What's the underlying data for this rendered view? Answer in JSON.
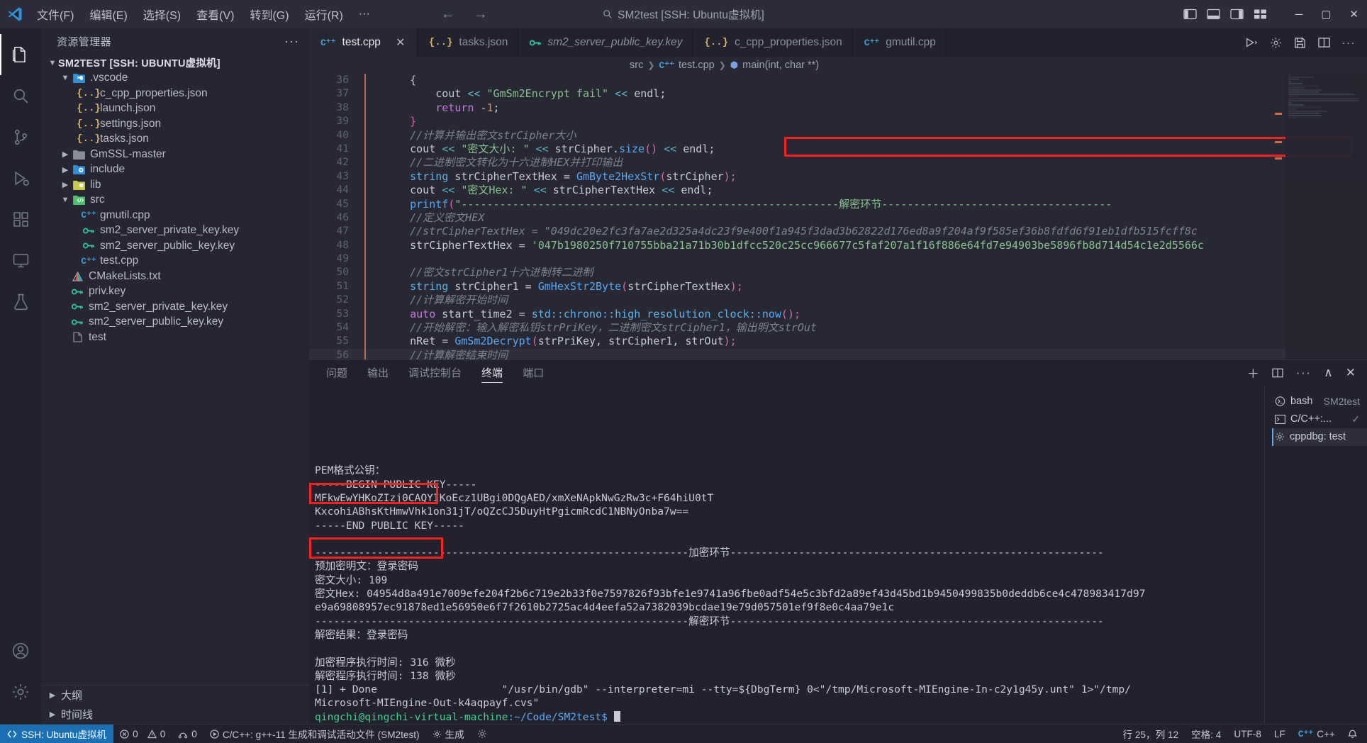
{
  "titlebar": {
    "menus": [
      "文件(F)",
      "编辑(E)",
      "选择(S)",
      "查看(V)",
      "转到(G)",
      "运行(R)",
      "···"
    ],
    "window_title": "SM2test [SSH: Ubuntu虚拟机]",
    "search_icon": "search-icon",
    "back_icon": "arrow-left-icon",
    "forward_icon": "arrow-right-icon",
    "minimize": "─",
    "maximize": "▢",
    "close": "✕"
  },
  "activitybar": {
    "items": [
      {
        "name": "explorer",
        "icon": "files-icon",
        "active": true
      },
      {
        "name": "search",
        "icon": "search-icon",
        "active": false
      },
      {
        "name": "source-control",
        "icon": "source-control-icon",
        "active": false
      },
      {
        "name": "run-debug",
        "icon": "debug-icon",
        "active": false
      },
      {
        "name": "extensions",
        "icon": "extensions-icon",
        "active": false
      },
      {
        "name": "remote-explorer",
        "icon": "remote-monitor-icon",
        "active": false
      },
      {
        "name": "testing",
        "icon": "beaker-icon",
        "active": false
      }
    ],
    "bottom": [
      {
        "name": "accounts",
        "icon": "account-icon"
      },
      {
        "name": "settings",
        "icon": "gear-icon"
      }
    ]
  },
  "sidebar": {
    "title": "资源管理器",
    "more_label": "···",
    "root": "SM2TEST [SSH: UBUNTU虚拟机]",
    "tree": [
      {
        "label": ".vscode",
        "indent": 1,
        "chev": "down",
        "icon": "folder-vscode-icon"
      },
      {
        "label": "c_cpp_properties.json",
        "indent": 2,
        "chev": "",
        "icon": "json-icon"
      },
      {
        "label": "launch.json",
        "indent": 2,
        "chev": "",
        "icon": "json-icon"
      },
      {
        "label": "settings.json",
        "indent": 2,
        "chev": "",
        "icon": "json-icon"
      },
      {
        "label": "tasks.json",
        "indent": 2,
        "chev": "",
        "icon": "json-icon"
      },
      {
        "label": "GmSSL-master",
        "indent": 1,
        "chev": "right",
        "icon": "folder-gray-icon"
      },
      {
        "label": "include",
        "indent": 1,
        "chev": "right",
        "icon": "folder-include-icon"
      },
      {
        "label": "lib",
        "indent": 1,
        "chev": "right",
        "icon": "folder-lib-icon"
      },
      {
        "label": "src",
        "indent": 1,
        "chev": "down",
        "icon": "folder-src-icon"
      },
      {
        "label": "gmutil.cpp",
        "indent": 2,
        "chev": "",
        "icon": "cpp-icon"
      },
      {
        "label": "sm2_server_private_key.key",
        "indent": 2,
        "chev": "",
        "icon": "key-icon"
      },
      {
        "label": "sm2_server_public_key.key",
        "indent": 2,
        "chev": "",
        "icon": "key-icon"
      },
      {
        "label": "test.cpp",
        "indent": 2,
        "chev": "",
        "icon": "cpp-icon"
      },
      {
        "label": "CMakeLists.txt",
        "indent": 1,
        "chev": "",
        "icon": "cmake-icon"
      },
      {
        "label": "priv.key",
        "indent": 1,
        "chev": "",
        "icon": "key-icon"
      },
      {
        "label": "sm2_server_private_key.key",
        "indent": 1,
        "chev": "",
        "icon": "key-icon"
      },
      {
        "label": "sm2_server_public_key.key",
        "indent": 1,
        "chev": "",
        "icon": "key-icon"
      },
      {
        "label": "test",
        "indent": 1,
        "chev": "",
        "icon": "file-icon"
      }
    ],
    "sections": [
      "大纲",
      "时间线"
    ]
  },
  "tabs": [
    {
      "label": "test.cpp",
      "icon": "cpp-icon",
      "active": true,
      "italic": false,
      "close": "✕"
    },
    {
      "label": "tasks.json",
      "icon": "json-icon",
      "active": false,
      "italic": false
    },
    {
      "label": "sm2_server_public_key.key",
      "icon": "key-icon",
      "active": false,
      "italic": true
    },
    {
      "label": "c_cpp_properties.json",
      "icon": "json-icon",
      "active": false,
      "italic": false
    },
    {
      "label": "gmutil.cpp",
      "icon": "cpp-icon",
      "active": false,
      "italic": false
    }
  ],
  "tabs_actions": [
    "run-icon",
    "gear-icon",
    "save-all-icon",
    "split-editor-icon",
    "more-actions-icon"
  ],
  "breadcrumb": [
    "src",
    "test.cpp",
    "main(int, char **)"
  ],
  "code": {
    "lines": [
      {
        "n": "36",
        "cur": false,
        "parts": [
          {
            "t": "    {",
            "c": "var"
          }
        ]
      },
      {
        "n": "37",
        "cur": false,
        "parts": [
          {
            "t": "        cout ",
            "c": "var"
          },
          {
            "t": "<< ",
            "c": "op"
          },
          {
            "t": "\"GmSm2Encrypt fail\"",
            "c": "st"
          },
          {
            "t": " << ",
            "c": "op"
          },
          {
            "t": "endl",
            "c": "var"
          },
          {
            "t": ";",
            "c": "var"
          }
        ]
      },
      {
        "n": "38",
        "cur": false,
        "parts": [
          {
            "t": "        ",
            "c": "var"
          },
          {
            "t": "return",
            "c": "k"
          },
          {
            "t": " -",
            "c": "var"
          },
          {
            "t": "1",
            "c": "num"
          },
          {
            "t": ";",
            "c": "var"
          }
        ]
      },
      {
        "n": "39",
        "cur": false,
        "parts": [
          {
            "t": "    }",
            "c": "pn"
          }
        ]
      },
      {
        "n": "40",
        "cur": false,
        "parts": [
          {
            "t": "    //计算并输出密文strCipher大小",
            "c": "cm"
          }
        ]
      },
      {
        "n": "41",
        "cur": false,
        "parts": [
          {
            "t": "    cout ",
            "c": "var"
          },
          {
            "t": "<< ",
            "c": "op"
          },
          {
            "t": "\"密文大小: \"",
            "c": "st"
          },
          {
            "t": " << ",
            "c": "op"
          },
          {
            "t": "strCipher.",
            "c": "var"
          },
          {
            "t": "size",
            "c": "fn"
          },
          {
            "t": "() ",
            "c": "pn"
          },
          {
            "t": "<< ",
            "c": "op"
          },
          {
            "t": "endl;",
            "c": "var"
          }
        ]
      },
      {
        "n": "42",
        "cur": false,
        "parts": [
          {
            "t": "    //二进制密文转化为十六进制HEX并打印输出",
            "c": "cm"
          }
        ]
      },
      {
        "n": "43",
        "cur": false,
        "parts": [
          {
            "t": "    ",
            "c": "var"
          },
          {
            "t": "string",
            "c": "kb"
          },
          {
            "t": " strCipherTextHex = ",
            "c": "var"
          },
          {
            "t": "GmByte2HexStr",
            "c": "fn"
          },
          {
            "t": "(",
            "c": "pn"
          },
          {
            "t": "strCipher",
            "c": "var"
          },
          {
            "t": ");",
            "c": "pn"
          }
        ]
      },
      {
        "n": "44",
        "cur": false,
        "parts": [
          {
            "t": "    cout ",
            "c": "var"
          },
          {
            "t": "<< ",
            "c": "op"
          },
          {
            "t": "\"密文Hex: \"",
            "c": "st"
          },
          {
            "t": " << ",
            "c": "op"
          },
          {
            "t": "strCipherTextHex ",
            "c": "var"
          },
          {
            "t": "<< ",
            "c": "op"
          },
          {
            "t": "endl;",
            "c": "var"
          }
        ]
      },
      {
        "n": "45",
        "cur": false,
        "parts": [
          {
            "t": "    ",
            "c": "var"
          },
          {
            "t": "printf",
            "c": "fn"
          },
          {
            "t": "(",
            "c": "pn"
          },
          {
            "t": "\"-----------------------------------------------------------解密环节------------------------------------",
            "c": "st"
          }
        ]
      },
      {
        "n": "46",
        "cur": false,
        "parts": [
          {
            "t": "    //定义密文HEX",
            "c": "cm"
          }
        ]
      },
      {
        "n": "47",
        "cur": false,
        "parts": [
          {
            "t": "    //strCipherTextHex = \"049dc20e2fc3fa7ae2d325a4dc23f9e400f1a945f3dad3b62822d176ed8a9f204af9f585ef36b8fdfd6f91eb1dfb515fcff8c",
            "c": "cm"
          }
        ]
      },
      {
        "n": "48",
        "cur": false,
        "parts": [
          {
            "t": "    strCipherTextHex = ",
            "c": "var"
          },
          {
            "t": "'047b1980250f710755bba21a71b30b1dfcc520c25cc966677c5faf207a1f16f886e64fd7e94903be5896fb8d714d54c1e2d5566c",
            "c": "st"
          }
        ]
      },
      {
        "n": "49",
        "cur": false,
        "parts": [
          {
            "t": "",
            "c": "var"
          }
        ]
      },
      {
        "n": "50",
        "cur": false,
        "parts": [
          {
            "t": "    //密文strCipher1十六进制转二进制",
            "c": "cm"
          }
        ]
      },
      {
        "n": "51",
        "cur": false,
        "parts": [
          {
            "t": "    ",
            "c": "var"
          },
          {
            "t": "string",
            "c": "kb"
          },
          {
            "t": " strCipher1 = ",
            "c": "var"
          },
          {
            "t": "GmHexStr2Byte",
            "c": "fn"
          },
          {
            "t": "(",
            "c": "pn"
          },
          {
            "t": "strCipherTextHex",
            "c": "var"
          },
          {
            "t": ");",
            "c": "pn"
          }
        ]
      },
      {
        "n": "52",
        "cur": false,
        "parts": [
          {
            "t": "    //计算解密开始时间",
            "c": "cm"
          }
        ]
      },
      {
        "n": "53",
        "cur": false,
        "parts": [
          {
            "t": "    ",
            "c": "var"
          },
          {
            "t": "auto",
            "c": "k"
          },
          {
            "t": " start_time2 = ",
            "c": "var"
          },
          {
            "t": "std::chrono::high_resolution_clock::",
            "c": "kb"
          },
          {
            "t": "now",
            "c": "fn"
          },
          {
            "t": "();",
            "c": "pn"
          }
        ]
      },
      {
        "n": "54",
        "cur": false,
        "parts": [
          {
            "t": "    //开始解密：输入解密私钥strPriKey，二进制密文strCipher1，输出明文strOut",
            "c": "cm"
          }
        ]
      },
      {
        "n": "55",
        "cur": false,
        "parts": [
          {
            "t": "    nRet = ",
            "c": "var"
          },
          {
            "t": "GmSm2Decrypt",
            "c": "fn"
          },
          {
            "t": "(",
            "c": "pn"
          },
          {
            "t": "strPriKey, strCipher1, strOut",
            "c": "var"
          },
          {
            "t": ");",
            "c": "pn"
          }
        ]
      },
      {
        "n": "56",
        "cur": true,
        "parts": [
          {
            "t": "    //计算解密结束时间",
            "c": "cm"
          }
        ]
      }
    ]
  },
  "panel": {
    "tabs": [
      "问题",
      "输出",
      "调试控制台",
      "终端",
      "端口"
    ],
    "active_tab": "终端",
    "actions": [
      "＋",
      "▭",
      "···",
      "∧",
      "✕"
    ],
    "terminal_lines": [
      "",
      "PEM格式公钥：",
      "-----BEGIN PUBLIC KEY-----",
      "MFkwEwYHKoZIzj0CAQYIKoEcz1UBgi0DQgAED/xmXeNApkNwGzRw3c+F64hiU0tT",
      "KxcohiABhsKtHmwVhk1on31jT/oQZcCJ5DuyHtPgicmRcdC1NBNyOnba7w==",
      "-----END PUBLIC KEY-----",
      "",
      "------------------------------------------------------------加密环节------------------------------------------------------------",
      "预加密明文：登录密码",
      "密文大小: 109",
      "密文Hex: 04954d8a491e7009efe204f2b6c719e2b33f0e7597826f93bfe1e9741a96fbe0adf54e5c3bfd2a89ef43d45bd1b9450499835b0deddb6ce4c478983417d97",
      "e9a69808957ec91878ed1e56950e6f7f2610b2725ac4d4eefa52a7382039bcdae19e79d057501ef9f8e0c4aa79e1c",
      "------------------------------------------------------------解密环节------------------------------------------------------------",
      "解密结果：登录密码",
      "",
      "加密程序执行时间: 316 微秒",
      "解密程序执行时间: 138 微秒",
      "[1] + Done                    \"/usr/bin/gdb\" --interpreter=mi --tty=${DbgTerm} 0<\"/tmp/Microsoft-MIEngine-In-c2y1g45y.unt\" 1>\"/tmp/",
      "Microsoft-MIEngine-Out-k4aqpayf.cvs\""
    ],
    "prompt_user": "qingchi@qingchi-virtual-machine",
    "prompt_path": ":~/Code/SM2test$",
    "side_items": [
      {
        "icon": "terminal-bash-icon",
        "name": "bash",
        "sub": "SM2test",
        "selected": false
      },
      {
        "icon": "terminal-icon",
        "name": "C/C++:...",
        "sub": "✓",
        "selected": false
      },
      {
        "icon": "gear-icon",
        "name": "cppdbg: test",
        "sub": "",
        "selected": true
      }
    ]
  },
  "statusbar": {
    "remote": "SSH: Ubuntu虚拟机",
    "remote_icon": "remote-icon",
    "errors": "0",
    "warnings": "0",
    "ports": "0",
    "build_task": "C/C++: g++-11 生成和调试活动文件 (SM2test)",
    "generate": "生成",
    "gear": "⚙",
    "gen_icon": "gear-icon",
    "right_items": [
      "行 25，列 12",
      "空格: 4",
      "UTF-8",
      "LF",
      "C++"
    ],
    "bell": "🔔",
    "accent": "#1b6fb3"
  },
  "annotations": {
    "redbox_color": "#ff1f1f",
    "boxes": [
      {
        "name": "code-hex-string-highlight"
      },
      {
        "name": "terminal-plaintext-highlight"
      },
      {
        "name": "terminal-decrypt-result-highlight"
      }
    ]
  }
}
